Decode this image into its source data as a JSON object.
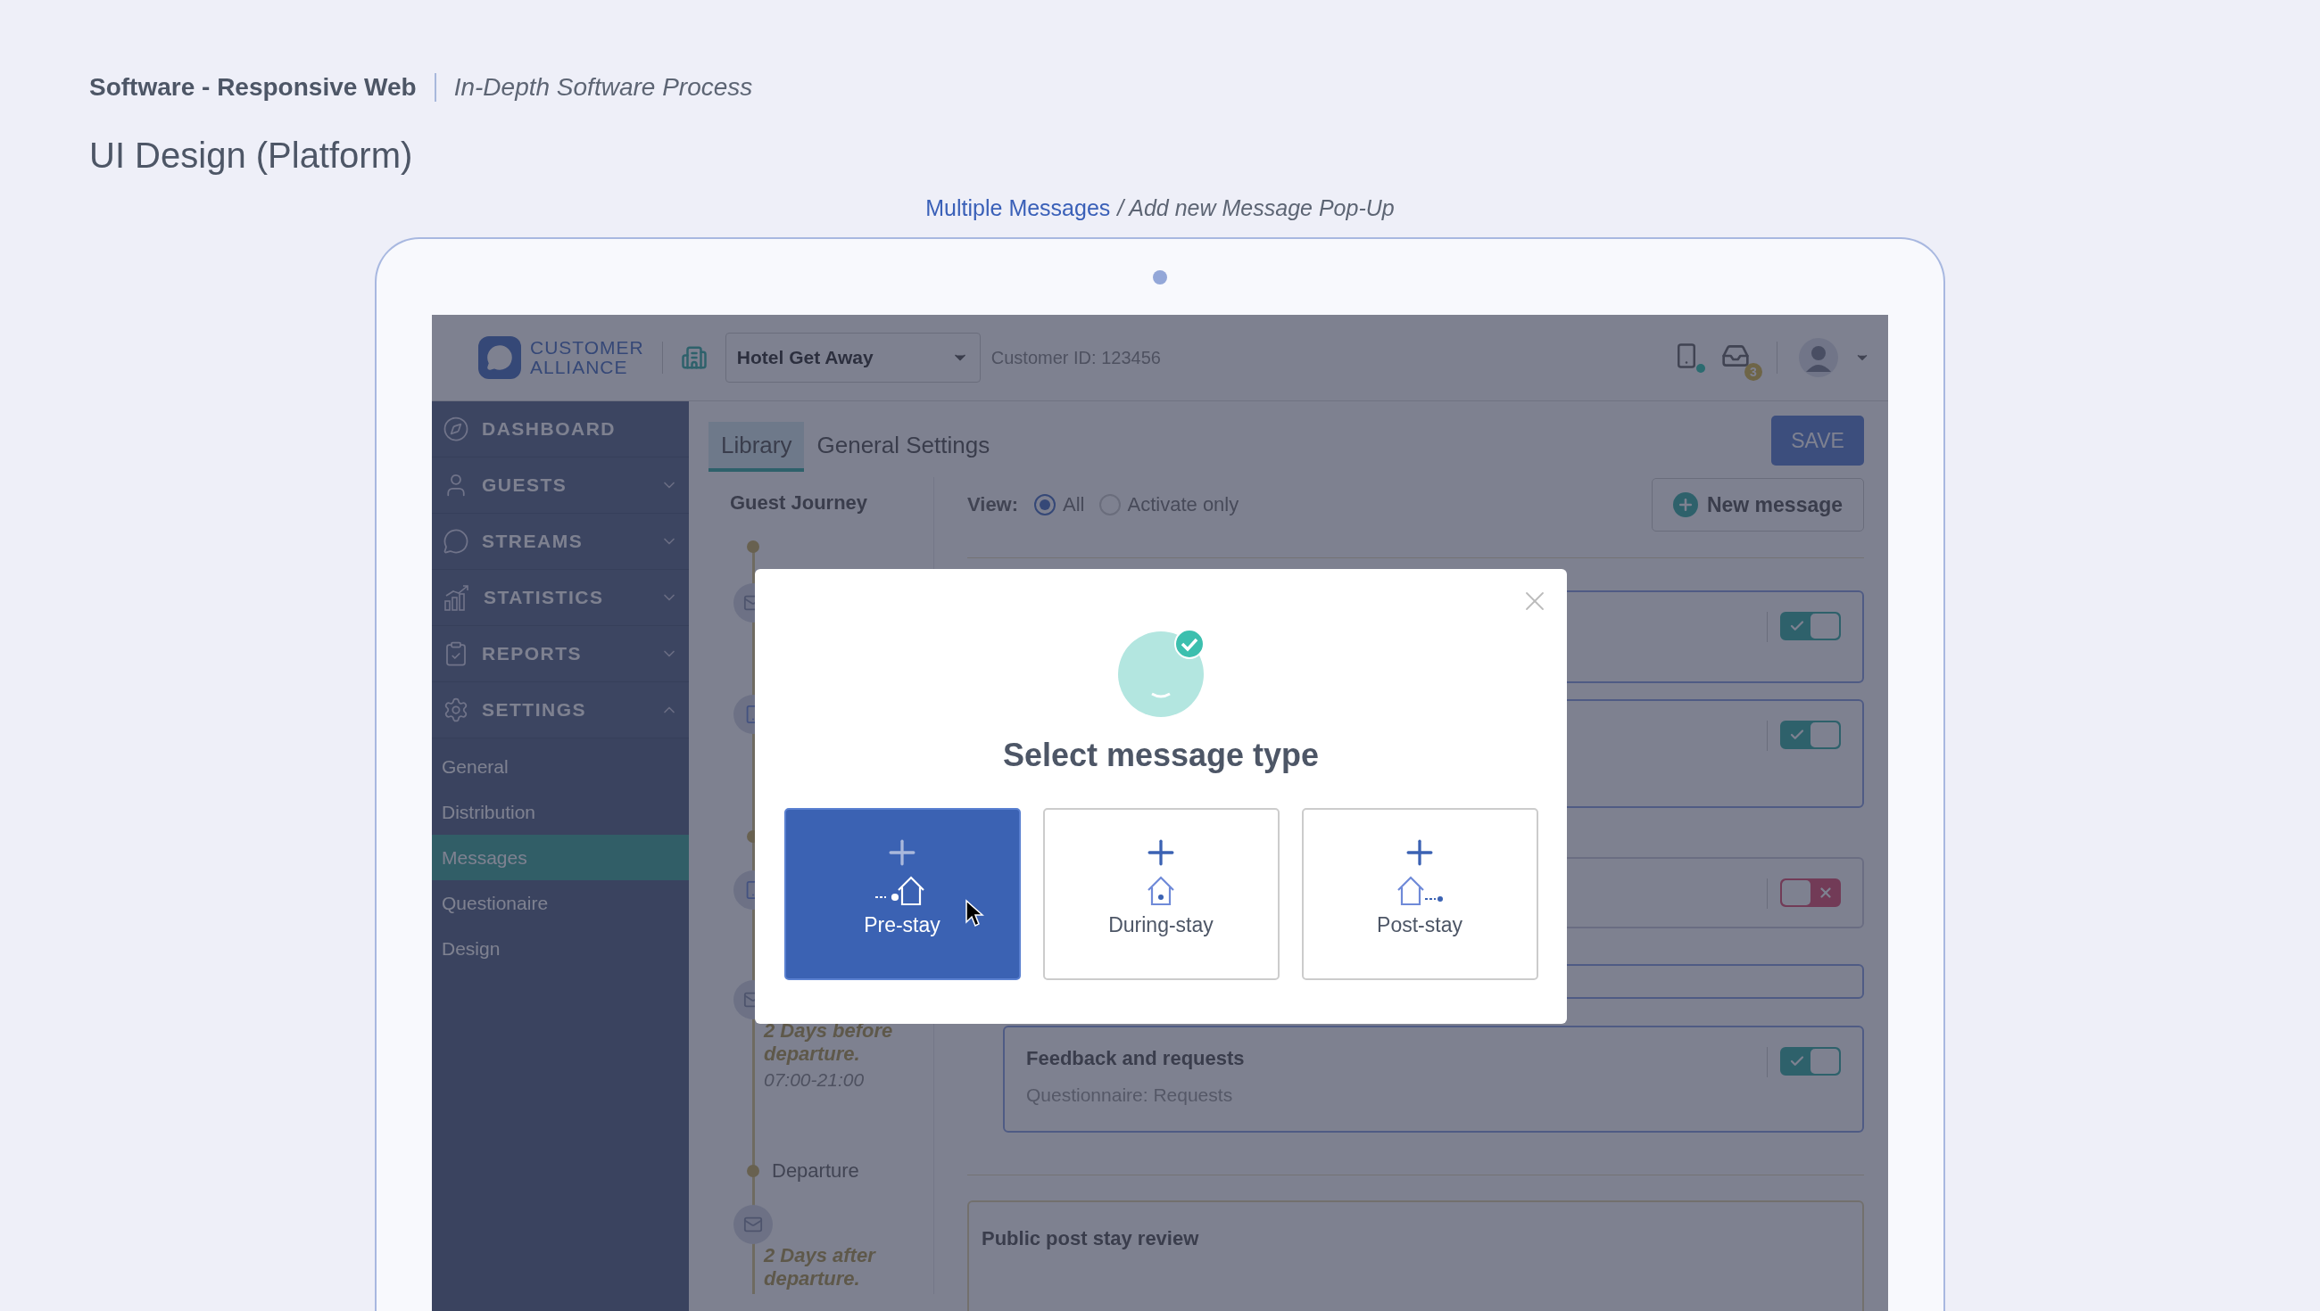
{
  "page_header": {
    "category": "Software - Responsive Web",
    "subtitle": "In-Depth Software Process",
    "title": "UI Design (Platform)"
  },
  "breadcrumb": {
    "link": "Multiple Messages",
    "current": "/ Add new Message Pop-Up"
  },
  "app_header": {
    "logo_top": "CUSTOMER",
    "logo_bottom": "ALLIANCE",
    "hotel": "Hotel Get Away",
    "customer_id": "Customer ID: 123456",
    "inbox_count": "3"
  },
  "sidebar": {
    "items": [
      {
        "label": "DASHBOARD",
        "kind": "link"
      },
      {
        "label": "GUESTS",
        "kind": "group",
        "expanded": false
      },
      {
        "label": "STREAMS",
        "kind": "group",
        "expanded": false
      },
      {
        "label": "STATISTICS",
        "kind": "group",
        "expanded": false
      },
      {
        "label": "REPORTS",
        "kind": "group",
        "expanded": false
      },
      {
        "label": "SETTINGS",
        "kind": "group",
        "expanded": true
      }
    ],
    "sub_items": [
      {
        "label": "General",
        "selected": false
      },
      {
        "label": "Distribution",
        "selected": false
      },
      {
        "label": "Messages",
        "selected": true
      },
      {
        "label": "Questionaire",
        "selected": false
      },
      {
        "label": "Design",
        "selected": false
      }
    ]
  },
  "tabs": [
    {
      "label": "Library",
      "selected": true
    },
    {
      "label": "General Settings",
      "selected": false
    }
  ],
  "save_button": "SAVE",
  "journey": {
    "title": "Guest Journey",
    "nodes": [
      {
        "kind": "stage"
      },
      {
        "kind": "mail"
      },
      {
        "kind": "phone"
      },
      {
        "kind": "stage"
      },
      {
        "kind": "phone"
      },
      {
        "kind": "mail",
        "title": "2 Days before departure.",
        "time": "07:00-21:00"
      },
      {
        "kind": "stage",
        "label": "Departure"
      },
      {
        "kind": "mail",
        "title": "2 Days after departure."
      }
    ]
  },
  "view": {
    "label": "View:",
    "options": [
      {
        "label": "All",
        "selected": true
      },
      {
        "label": "Activate only",
        "selected": false
      }
    ]
  },
  "new_message_button": "New message",
  "cards": [
    {
      "kind": "message",
      "on": true
    },
    {
      "kind": "message",
      "on": true
    },
    {
      "kind": "message",
      "on": false
    },
    {
      "kind": "condition"
    },
    {
      "kind": "message",
      "title": "Feedback and requests",
      "subtitle": "Questionnaire: Requests",
      "on": true
    },
    {
      "kind": "review",
      "title": "Public post stay review"
    }
  ],
  "modal": {
    "title": "Select message type",
    "options": [
      {
        "label": "Pre-stay",
        "kind": "pre",
        "selected": true
      },
      {
        "label": "During-stay",
        "kind": "during",
        "selected": false
      },
      {
        "label": "Post-stay",
        "kind": "post",
        "selected": false
      }
    ]
  }
}
